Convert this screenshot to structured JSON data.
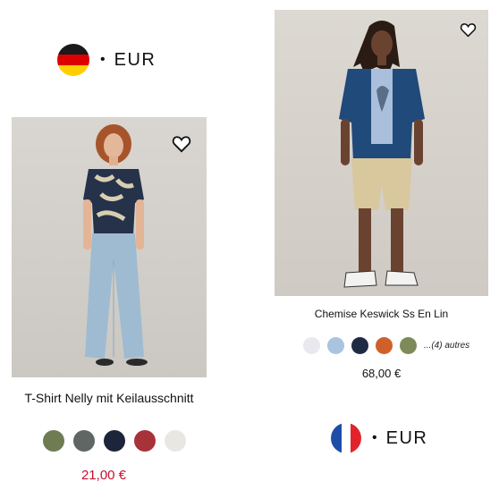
{
  "de_block": {
    "flag": "germany-flag",
    "currency": "EUR",
    "separator": "•",
    "product": {
      "name": "T-Shirt Nelly mit Keilausschnitt",
      "price": "21,00 €",
      "price_color": "#c8102e",
      "swatches": [
        "#6f7b52",
        "#5f6664",
        "#1c2539",
        "#a8323a",
        "#e9e7e2"
      ]
    }
  },
  "fr_block": {
    "flag": "france-flag",
    "currency": "EUR",
    "separator": "•",
    "product": {
      "name": "Chemise Keswick Ss En Lin",
      "price": "68,00 €",
      "price_color": "#111111",
      "swatches": [
        "#e8e8ee",
        "#aac4e0",
        "#1f2a44",
        "#d0602a",
        "#7f8a5a"
      ],
      "more_label": "...(4) autres"
    }
  },
  "icons": {
    "wishlist": "heart-icon"
  }
}
